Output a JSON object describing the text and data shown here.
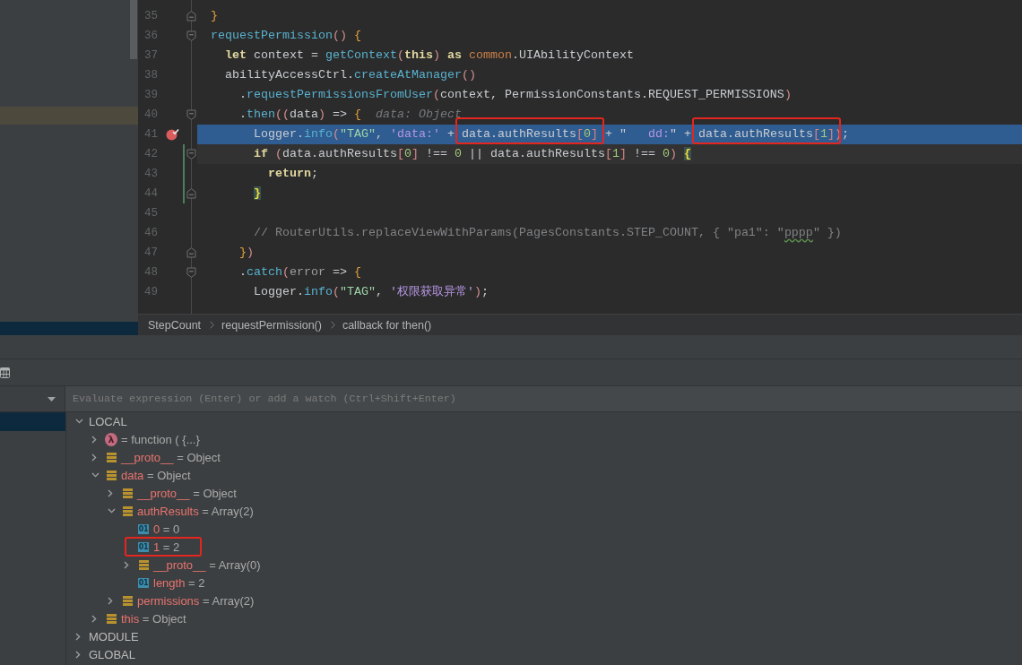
{
  "editor": {
    "lines": [
      {
        "number": "35",
        "fold_start": false,
        "fold_end": true,
        "breakpoint": false,
        "execution_point": false,
        "caret_line": false,
        "modified": false,
        "segments": [
          {
            "boxed": false,
            "tokens": [
              {
                "text": "}",
                "kind": "brace"
              }
            ]
          }
        ]
      },
      {
        "number": "36",
        "fold_start": true,
        "fold_end": false,
        "breakpoint": false,
        "execution_point": false,
        "caret_line": false,
        "modified": false,
        "segments": [
          {
            "boxed": false,
            "tokens": [
              {
                "text": "requestPermission",
                "kind": "method"
              },
              {
                "text": "()",
                "kind": "paren"
              },
              {
                "text": " {",
                "kind": "brace"
              }
            ]
          }
        ]
      },
      {
        "number": "37",
        "fold_start": false,
        "fold_end": false,
        "breakpoint": false,
        "execution_point": false,
        "caret_line": false,
        "modified": false,
        "segments": [
          {
            "boxed": false,
            "tokens": [
              {
                "text": "  let",
                "kind": "keyword"
              },
              {
                "text": " context = ",
                "kind": "plain"
              },
              {
                "text": "getContext",
                "kind": "method"
              },
              {
                "text": "(",
                "kind": "paren"
              },
              {
                "text": "this",
                "kind": "keyword"
              },
              {
                "text": ")",
                "kind": "paren"
              },
              {
                "text": " as ",
                "kind": "keyword"
              },
              {
                "text": "common",
                "kind": "type"
              },
              {
                "text": ".UIAbilityContext",
                "kind": "plain"
              }
            ]
          }
        ]
      },
      {
        "number": "38",
        "fold_start": false,
        "fold_end": false,
        "breakpoint": false,
        "execution_point": false,
        "caret_line": false,
        "modified": false,
        "segments": [
          {
            "boxed": false,
            "tokens": [
              {
                "text": "  abilityAccessCtrl.",
                "kind": "plain"
              },
              {
                "text": "createAtManager",
                "kind": "method"
              },
              {
                "text": "()",
                "kind": "paren"
              }
            ]
          }
        ]
      },
      {
        "number": "39",
        "fold_start": false,
        "fold_end": false,
        "breakpoint": false,
        "execution_point": false,
        "caret_line": false,
        "modified": false,
        "segments": [
          {
            "boxed": false,
            "tokens": [
              {
                "text": "    .",
                "kind": "plain"
              },
              {
                "text": "requestPermissionsFromUser",
                "kind": "method"
              },
              {
                "text": "(",
                "kind": "paren"
              },
              {
                "text": "context, PermissionConstants.REQUEST_PERMISSIONS",
                "kind": "plain"
              },
              {
                "text": ")",
                "kind": "paren"
              }
            ]
          }
        ]
      },
      {
        "number": "40",
        "fold_start": true,
        "fold_end": false,
        "breakpoint": false,
        "execution_point": false,
        "caret_line": false,
        "modified": false,
        "segments": [
          {
            "boxed": false,
            "tokens": [
              {
                "text": "    .",
                "kind": "plain"
              },
              {
                "text": "then",
                "kind": "method"
              },
              {
                "text": "((",
                "kind": "paren"
              },
              {
                "text": "data",
                "kind": "plain"
              },
              {
                "text": ")",
                "kind": "paren"
              },
              {
                "text": " => ",
                "kind": "plain"
              },
              {
                "text": "{",
                "kind": "brace"
              },
              {
                "text": "  data: Object",
                "kind": "hint"
              }
            ]
          }
        ]
      },
      {
        "number": "41",
        "fold_start": false,
        "fold_end": false,
        "breakpoint": true,
        "execution_point": true,
        "caret_line": false,
        "modified": false,
        "segments": [
          {
            "boxed": false,
            "tokens": [
              {
                "text": "      Logger.",
                "kind": "plain"
              },
              {
                "text": "info",
                "kind": "method"
              },
              {
                "text": "(",
                "kind": "paren"
              },
              {
                "text": "\"TAG\"",
                "kind": "string"
              },
              {
                "text": ", ",
                "kind": "plain"
              },
              {
                "text": "'data:'",
                "kind": "string2"
              },
              {
                "text": " + ",
                "kind": "plain"
              }
            ]
          },
          {
            "boxed": true,
            "tokens": [
              {
                "text": "data.authResults",
                "kind": "plain"
              },
              {
                "text": "[",
                "kind": "bracket"
              },
              {
                "text": "0",
                "kind": "number"
              },
              {
                "text": "]",
                "kind": "bracket"
              }
            ]
          },
          {
            "boxed": false,
            "tokens": [
              {
                "text": " + \"",
                "kind": "plain"
              },
              {
                "text": "   dd:",
                "kind": "string2"
              },
              {
                "text": "\" + ",
                "kind": "plain"
              }
            ]
          },
          {
            "boxed": true,
            "tokens": [
              {
                "text": "data.authResults",
                "kind": "plain"
              },
              {
                "text": "[",
                "kind": "bracket"
              },
              {
                "text": "1",
                "kind": "number"
              },
              {
                "text": "]",
                "kind": "bracket"
              }
            ]
          },
          {
            "boxed": false,
            "tokens": [
              {
                "text": ")",
                "kind": "paren"
              },
              {
                "text": ";",
                "kind": "plain"
              }
            ]
          }
        ]
      },
      {
        "number": "42",
        "fold_start": true,
        "fold_end": false,
        "breakpoint": false,
        "execution_point": false,
        "caret_line": true,
        "modified": true,
        "segments": [
          {
            "boxed": false,
            "tokens": [
              {
                "text": "      if",
                "kind": "keyword"
              },
              {
                "text": " (",
                "kind": "paren"
              },
              {
                "text": "data.authResults",
                "kind": "plain"
              },
              {
                "text": "[",
                "kind": "bracket"
              },
              {
                "text": "0",
                "kind": "number"
              },
              {
                "text": "]",
                "kind": "bracket"
              },
              {
                "text": " !== ",
                "kind": "plain"
              },
              {
                "text": "0",
                "kind": "number"
              },
              {
                "text": " || data.authResults",
                "kind": "plain"
              },
              {
                "text": "[",
                "kind": "bracket"
              },
              {
                "text": "1",
                "kind": "number"
              },
              {
                "text": "]",
                "kind": "bracket"
              },
              {
                "text": " !== ",
                "kind": "plain"
              },
              {
                "text": "0",
                "kind": "number"
              },
              {
                "text": ") ",
                "kind": "paren"
              },
              {
                "text": "{",
                "kind": "match"
              }
            ]
          }
        ]
      },
      {
        "number": "43",
        "fold_start": false,
        "fold_end": false,
        "breakpoint": false,
        "execution_point": false,
        "caret_line": false,
        "modified": true,
        "segments": [
          {
            "boxed": false,
            "tokens": [
              {
                "text": "        return",
                "kind": "keyword"
              },
              {
                "text": ";",
                "kind": "plain"
              }
            ]
          }
        ]
      },
      {
        "number": "44",
        "fold_start": false,
        "fold_end": true,
        "breakpoint": false,
        "execution_point": false,
        "caret_line": false,
        "modified": true,
        "segments": [
          {
            "boxed": false,
            "tokens": [
              {
                "text": "      }",
                "kind": "match"
              }
            ]
          }
        ]
      },
      {
        "number": "45",
        "fold_start": false,
        "fold_end": false,
        "breakpoint": false,
        "execution_point": false,
        "caret_line": false,
        "modified": false
      },
      {
        "number": "46",
        "fold_start": false,
        "fold_end": false,
        "breakpoint": false,
        "execution_point": false,
        "caret_line": false,
        "modified": false,
        "segments": [
          {
            "boxed": false,
            "tokens": [
              {
                "text": "      // RouterUtils.replaceViewWithParams(PagesConstants.STEP_COUNT, { \"pa1\": \"",
                "kind": "comment"
              },
              {
                "text": "pppp",
                "kind": "typo"
              },
              {
                "text": "\" })",
                "kind": "comment"
              }
            ]
          }
        ]
      },
      {
        "number": "47",
        "fold_start": false,
        "fold_end": true,
        "breakpoint": false,
        "execution_point": false,
        "caret_line": false,
        "modified": false,
        "segments": [
          {
            "boxed": false,
            "tokens": [
              {
                "text": "    }",
                "kind": "brace"
              },
              {
                "text": ")",
                "kind": "paren"
              }
            ]
          }
        ]
      },
      {
        "number": "48",
        "fold_start": true,
        "fold_end": false,
        "breakpoint": false,
        "execution_point": false,
        "caret_line": false,
        "modified": false,
        "segments": [
          {
            "boxed": false,
            "tokens": [
              {
                "text": "    .",
                "kind": "plain"
              },
              {
                "text": "catch",
                "kind": "method"
              },
              {
                "text": "(",
                "kind": "paren"
              },
              {
                "text": "error",
                "kind": "param"
              },
              {
                "text": " => ",
                "kind": "plain"
              },
              {
                "text": "{",
                "kind": "brace"
              }
            ]
          }
        ]
      },
      {
        "number": "49",
        "fold_start": false,
        "fold_end": false,
        "breakpoint": false,
        "execution_point": false,
        "caret_line": false,
        "modified": false,
        "segments": [
          {
            "boxed": false,
            "tokens": [
              {
                "text": "      Logger.",
                "kind": "plain"
              },
              {
                "text": "info",
                "kind": "method"
              },
              {
                "text": "(",
                "kind": "paren"
              },
              {
                "text": "\"TAG\"",
                "kind": "string"
              },
              {
                "text": ", ",
                "kind": "plain"
              },
              {
                "text": "'权限获取异常'",
                "kind": "string2"
              },
              {
                "text": ")",
                "kind": "paren"
              },
              {
                "text": ";",
                "kind": "plain"
              }
            ]
          }
        ]
      }
    ]
  },
  "breadcrumb": [
    "StepCount",
    "requestPermission()",
    "callback for then()"
  ],
  "debugger": {
    "evaluate": {
      "placeholder": "Evaluate expression (Enter) or add a watch (Ctrl+Shift+Enter)"
    },
    "scopes": [
      {
        "name": "LOCAL",
        "expanded": true,
        "children": [
          {
            "kind": "function",
            "badge": "λ",
            "value": "= function ( {...}",
            "expanded": false,
            "boxed": false
          },
          {
            "kind": "object",
            "name": "__proto__",
            "value": "= Object",
            "expanded": false,
            "boxed": false
          },
          {
            "kind": "object",
            "name": "data",
            "value": "= Object",
            "expanded": true,
            "boxed": false,
            "children": [
              {
                "kind": "object",
                "name": "__proto__",
                "value": "= Object",
                "expanded": false,
                "boxed": false
              },
              {
                "kind": "object",
                "name": "authResults",
                "value": "= Array(2)",
                "expanded": true,
                "boxed": false,
                "children": [
                  {
                    "kind": "primitive",
                    "badge": "01",
                    "name": "0",
                    "value": "= 0",
                    "boxed": false
                  },
                  {
                    "kind": "primitive",
                    "badge": "01",
                    "name": "1",
                    "value": "= 2",
                    "boxed": true
                  },
                  {
                    "kind": "object",
                    "name": "__proto__",
                    "value": "= Array(0)",
                    "expanded": false,
                    "boxed": false
                  },
                  {
                    "kind": "primitive",
                    "badge": "01",
                    "name": "length",
                    "value": "= 2",
                    "boxed": false
                  }
                ]
              },
              {
                "kind": "object",
                "name": "permissions",
                "value": "= Array(2)",
                "expanded": false,
                "boxed": false
              }
            ]
          },
          {
            "kind": "object",
            "name": "this",
            "value": "= Object",
            "expanded": false,
            "boxed": false
          }
        ]
      },
      {
        "name": "MODULE",
        "expanded": false
      },
      {
        "name": "GLOBAL",
        "expanded": false
      }
    ]
  }
}
